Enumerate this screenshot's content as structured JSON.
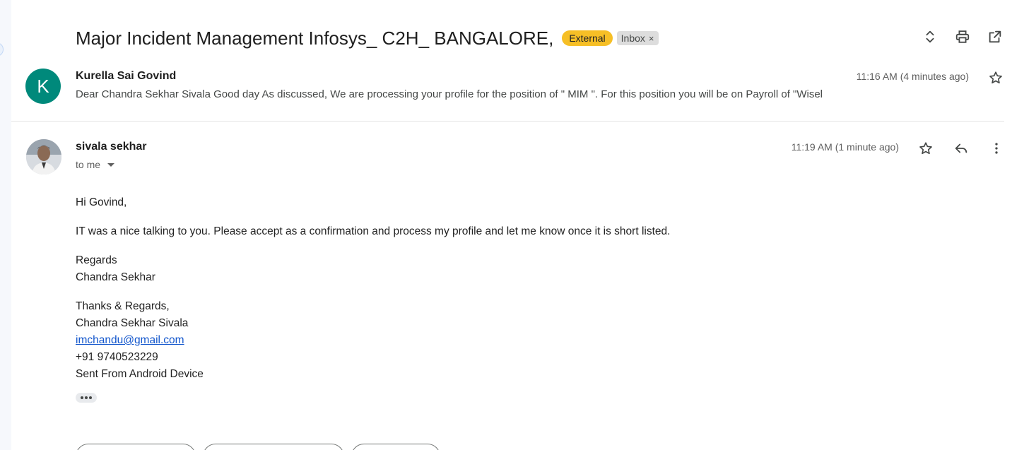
{
  "thread": {
    "subject": "Major Incident Management Infosys_ C2H_ BANGALORE,",
    "labels": {
      "external": "External",
      "inbox": "Inbox",
      "inbox_remove": "×"
    },
    "header_icons": [
      "navigate-up-down-icon",
      "print-icon",
      "open-in-new-window-icon"
    ]
  },
  "collapsed_message": {
    "avatar_letter": "K",
    "avatar_color": "#00897b",
    "sender": "Kurella Sai Govind",
    "snippet": "Dear Chandra Sekhar Sivala Good day As discussed, We are processing your profile for the position of \" MIM \". For this position you will be on Payroll of \"Wisel",
    "time": "11:16 AM (4 minutes ago)"
  },
  "expanded_message": {
    "sender": "sivala sekhar",
    "recipient": "to me",
    "time": "11:19 AM (1 minute ago)",
    "body": {
      "greeting": "Hi Govind,",
      "paragraph": "IT was a nice talking to you. Please accept as a confirmation and process my profile and let me know once it is short listed.",
      "regards_1": "Regards",
      "regards_2": "Chandra Sekhar",
      "sig_1": "Thanks & Regards,",
      "sig_2": "Chandra Sekhar Sivala",
      "sig_email": "imchandu@gmail.com",
      "sig_phone": "+91 9740523229",
      "sig_device": "Sent From Android Device"
    }
  },
  "colors": {
    "external_label": "#f6bf26",
    "inbox_label": "#dddddd",
    "link": "#1155cc"
  }
}
